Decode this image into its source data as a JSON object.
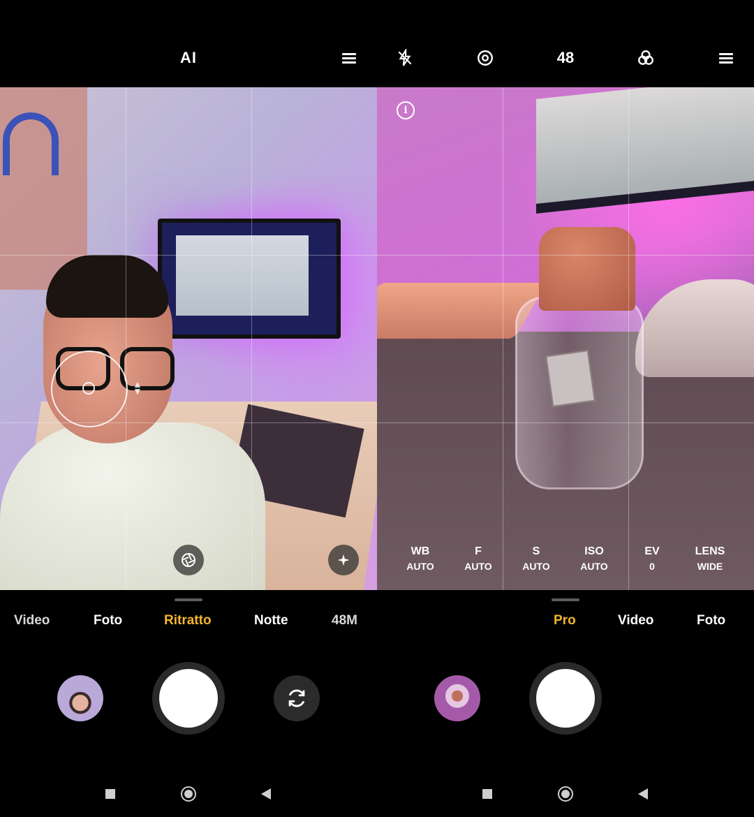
{
  "left": {
    "top_bar": {
      "ai_label": "AI",
      "menu_icon": "menu-icon"
    },
    "viewfinder": {
      "icons": [
        "aperture-icon",
        "magic-sparkle-icon"
      ]
    },
    "modes": [
      {
        "label": "Video",
        "active": false
      },
      {
        "label": "Foto",
        "active": false
      },
      {
        "label": "Ritratto",
        "active": true
      },
      {
        "label": "Notte",
        "active": false
      },
      {
        "label": "48M",
        "active": false
      }
    ],
    "controls": {
      "gallery_icon": "gallery-thumbnail",
      "switch_icon": "camera-switch-icon"
    },
    "nav": [
      "recents-square-icon",
      "home-circle-icon",
      "back-triangle-icon"
    ]
  },
  "right": {
    "top_bar": {
      "flash_icon": "flash-off-icon",
      "timer_icon": "focus-target-icon",
      "resolution_label": "48",
      "filters_icon": "filters-icon",
      "menu_icon": "menu-icon"
    },
    "viewfinder": {
      "info_icon": "info-icon"
    },
    "pro_controls": [
      {
        "label": "WB",
        "value": "AUTO"
      },
      {
        "label": "F",
        "value": "AUTO"
      },
      {
        "label": "S",
        "value": "AUTO"
      },
      {
        "label": "ISO",
        "value": "AUTO"
      },
      {
        "label": "EV",
        "value": "0"
      },
      {
        "label": "LENS",
        "value": "WIDE"
      }
    ],
    "modes": [
      {
        "label": "Pro",
        "active": true
      },
      {
        "label": "Video",
        "active": false
      },
      {
        "label": "Foto",
        "active": false
      }
    ],
    "nav": [
      "recents-square-icon",
      "home-circle-icon",
      "back-triangle-icon"
    ]
  },
  "colors": {
    "accent": "#f5b530",
    "background": "#000000",
    "shutter": "#ffffff"
  }
}
